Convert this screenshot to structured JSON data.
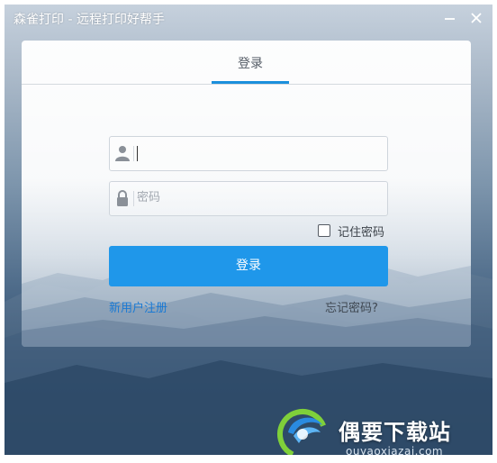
{
  "window": {
    "title": "森雀打印 - 远程打印好帮手",
    "minimize_icon": "minimize-icon",
    "close_icon": "close-icon"
  },
  "login": {
    "tab_label": "登录",
    "username": {
      "value": "",
      "placeholder": "",
      "icon": "user-icon"
    },
    "password": {
      "value": "",
      "placeholder": "密码",
      "icon": "lock-icon"
    },
    "remember_label": "记住密码",
    "remember_checked": false,
    "submit_label": "登录",
    "register_link": "新用户注册",
    "forgot_link": "忘记密码?"
  },
  "watermark": {
    "text": "偶要下载站",
    "url": "ouyaoxiazai.com"
  },
  "colors": {
    "accent": "#1f97ea",
    "link": "#1a7ad4",
    "tab_indicator": "#1c8fdc"
  }
}
